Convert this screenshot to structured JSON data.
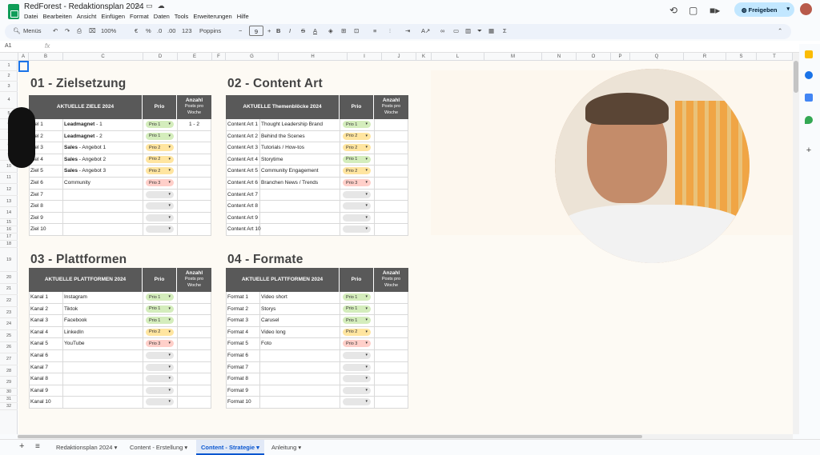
{
  "app": {
    "title": "RedForest - Redaktionsplan 2024",
    "share_label": "Freigeben",
    "menus": [
      "Datei",
      "Bearbeiten",
      "Ansicht",
      "Einfügen",
      "Format",
      "Daten",
      "Tools",
      "Erweiterungen",
      "Hilfe"
    ]
  },
  "toolbar": {
    "search_label": "Menüs",
    "zoom": "100%",
    "currency": "€",
    "percent": "%",
    "dec_less": ".0",
    "dec_more": ".00",
    "number_format": "123",
    "font": "Poppins",
    "font_size": "9"
  },
  "formula": {
    "cell_ref": "A1",
    "fx": "fx"
  },
  "columns": [
    "A",
    "B",
    "C",
    "D",
    "E",
    "F",
    "G",
    "H",
    "I",
    "J",
    "K",
    "L",
    "M",
    "N",
    "O",
    "P",
    "Q",
    "R",
    "S",
    "T"
  ],
  "rows": [
    "1",
    "2",
    "3",
    "4",
    "5",
    "6",
    "7",
    "8",
    "9",
    "10",
    "11",
    "12",
    "13",
    "14",
    "15",
    "16",
    "17",
    "18",
    "19",
    "20",
    "21",
    "22",
    "23",
    "24",
    "25",
    "26",
    "27",
    "28",
    "29",
    "30",
    "31",
    "32"
  ],
  "sections": {
    "s1": {
      "title": "01 - Zielsetzung",
      "h1": "AKTUELLE ZIELE 2024",
      "h2": "Prio",
      "h3a": "Anzahl",
      "h3b": "Posts pro",
      "h3c": "Woche",
      "rows": [
        {
          "a": "Ziel 1",
          "b_bold": "Leadmagnet",
          "b": " - 1",
          "prio": "Prio 1",
          "cls": "p1",
          "n": "1 - 2"
        },
        {
          "a": "Ziel 2",
          "b_bold": "Leadmagnet",
          "b": " - 2",
          "prio": "Prio 1",
          "cls": "p1",
          "n": ""
        },
        {
          "a": "Ziel 3",
          "b_bold": "Sales",
          "b": " - Angebot 1",
          "prio": "Prio 2",
          "cls": "p2",
          "n": ""
        },
        {
          "a": "Ziel 4",
          "b_bold": "Sales",
          "b": " - Angebot 2",
          "prio": "Prio 2",
          "cls": "p2",
          "n": ""
        },
        {
          "a": "Ziel 5",
          "b_bold": "Sales",
          "b": " - Angebot 3",
          "prio": "Prio 2",
          "cls": "p2",
          "n": ""
        },
        {
          "a": "Ziel 6",
          "b_bold": "",
          "b": "Community",
          "prio": "Prio 3",
          "cls": "p3",
          "n": ""
        },
        {
          "a": "Ziel 7",
          "b_bold": "",
          "b": "",
          "prio": "",
          "cls": "empty",
          "n": ""
        },
        {
          "a": "Ziel 8",
          "b_bold": "",
          "b": "",
          "prio": "",
          "cls": "empty",
          "n": ""
        },
        {
          "a": "Ziel 9",
          "b_bold": "",
          "b": "",
          "prio": "",
          "cls": "empty",
          "n": ""
        },
        {
          "a": "Ziel 10",
          "b_bold": "",
          "b": "",
          "prio": "",
          "cls": "empty",
          "n": ""
        }
      ]
    },
    "s2": {
      "title": "02 - Content Art",
      "h1": "AKTUELLE Themenblöcke  2024",
      "h2": "Prio",
      "h3a": "Anzahl",
      "h3b": "Posts pro",
      "h3c": "Woche",
      "rows": [
        {
          "a": "Content Art 1",
          "b_bold": "",
          "b": "Thought Leadership Brand",
          "prio": "Prio 1",
          "cls": "p1",
          "n": ""
        },
        {
          "a": "Content Art 2",
          "b_bold": "",
          "b": "Behind the Scenes",
          "prio": "Prio 2",
          "cls": "p2",
          "n": ""
        },
        {
          "a": "Content Art 3",
          "b_bold": "",
          "b": "Tutorials / How-tos",
          "prio": "Prio 2",
          "cls": "p2",
          "n": ""
        },
        {
          "a": "Content Art 4",
          "b_bold": "",
          "b": "Storytime",
          "prio": "Prio 1",
          "cls": "p1",
          "n": ""
        },
        {
          "a": "Content Art 5",
          "b_bold": "",
          "b": "Community Engagement",
          "prio": "Prio 2",
          "cls": "p2",
          "n": ""
        },
        {
          "a": "Content Art 6",
          "b_bold": "",
          "b": "Branchen News / Trends",
          "prio": "Prio 3",
          "cls": "p3",
          "n": ""
        },
        {
          "a": "Content Art 7",
          "b_bold": "",
          "b": "",
          "prio": "",
          "cls": "empty",
          "n": ""
        },
        {
          "a": "Content Art 8",
          "b_bold": "",
          "b": "",
          "prio": "",
          "cls": "empty",
          "n": ""
        },
        {
          "a": "Content Art 9",
          "b_bold": "",
          "b": "",
          "prio": "",
          "cls": "empty",
          "n": ""
        },
        {
          "a": "Content Art 10",
          "b_bold": "",
          "b": "",
          "prio": "",
          "cls": "empty",
          "n": ""
        }
      ]
    },
    "s3": {
      "title": "03 - Plattformen",
      "h1": "AKTUELLE PLATTFORMEN 2024",
      "h2": "Prio",
      "h3a": "Anzahl",
      "h3b": "Posts pro",
      "h3c": "Woche",
      "rows": [
        {
          "a": "Kanal 1",
          "b_bold": "",
          "b": "Instagram",
          "prio": "Prio 1",
          "cls": "p1",
          "n": ""
        },
        {
          "a": "Kanal 2",
          "b_bold": "",
          "b": "Tiktok",
          "prio": "Prio 1",
          "cls": "p1",
          "n": ""
        },
        {
          "a": "Kanal 3",
          "b_bold": "",
          "b": "Facebook",
          "prio": "Prio 1",
          "cls": "p1",
          "n": ""
        },
        {
          "a": "Kanal 4",
          "b_bold": "",
          "b": "LinkedIn",
          "prio": "Prio 2",
          "cls": "p2",
          "n": ""
        },
        {
          "a": "Kanal 5",
          "b_bold": "",
          "b": "YouTube",
          "prio": "Prio 3",
          "cls": "p3",
          "n": ""
        },
        {
          "a": "Kanal 6",
          "b_bold": "",
          "b": "",
          "prio": "",
          "cls": "empty",
          "n": ""
        },
        {
          "a": "Kanal 7",
          "b_bold": "",
          "b": "",
          "prio": "",
          "cls": "empty",
          "n": ""
        },
        {
          "a": "Kanal 8",
          "b_bold": "",
          "b": "",
          "prio": "",
          "cls": "empty",
          "n": ""
        },
        {
          "a": "Kanal 9",
          "b_bold": "",
          "b": "",
          "prio": "",
          "cls": "empty",
          "n": ""
        },
        {
          "a": "Kanal 10",
          "b_bold": "",
          "b": "",
          "prio": "",
          "cls": "empty",
          "n": ""
        }
      ]
    },
    "s4": {
      "title": "04 - Formate",
      "h1": "AKTUELLE PLATTFORMEN 2024",
      "h2": "Prio",
      "h3a": "Anzahl",
      "h3b": "Posts pro",
      "h3c": "Woche",
      "rows": [
        {
          "a": "Format 1",
          "b_bold": "",
          "b": "Video short",
          "prio": "Prio 1",
          "cls": "p1",
          "n": ""
        },
        {
          "a": "Format 2",
          "b_bold": "",
          "b": "Storys",
          "prio": "Prio 1",
          "cls": "p1",
          "n": ""
        },
        {
          "a": "Format 3",
          "b_bold": "",
          "b": "Carusel",
          "prio": "Prio 1",
          "cls": "p1",
          "n": ""
        },
        {
          "a": "Format 4",
          "b_bold": "",
          "b": "Video long",
          "prio": "Prio 2",
          "cls": "p2",
          "n": ""
        },
        {
          "a": "Format 5",
          "b_bold": "",
          "b": "Foto",
          "prio": "Prio 3",
          "cls": "p3",
          "n": ""
        },
        {
          "a": "Format 6",
          "b_bold": "",
          "b": "",
          "prio": "",
          "cls": "empty",
          "n": ""
        },
        {
          "a": "Format 7",
          "b_bold": "",
          "b": "",
          "prio": "",
          "cls": "empty",
          "n": ""
        },
        {
          "a": "Format 8",
          "b_bold": "",
          "b": "",
          "prio": "",
          "cls": "empty",
          "n": ""
        },
        {
          "a": "Format 9",
          "b_bold": "",
          "b": "",
          "prio": "",
          "cls": "empty",
          "n": ""
        },
        {
          "a": "Format 10",
          "b_bold": "",
          "b": "",
          "prio": "",
          "cls": "empty",
          "n": ""
        }
      ]
    }
  },
  "tabs": [
    "Redaktionsplan 2024",
    "Content - Erstellung",
    "Content - Strategie",
    "Anleitung"
  ],
  "active_tab": "Content - Strategie",
  "colors": {
    "header_dark": "#595959",
    "prio1": "#d4edbc",
    "prio2": "#ffe5a0",
    "prio3": "#ffcfc9",
    "accent": "#0b57d0"
  }
}
